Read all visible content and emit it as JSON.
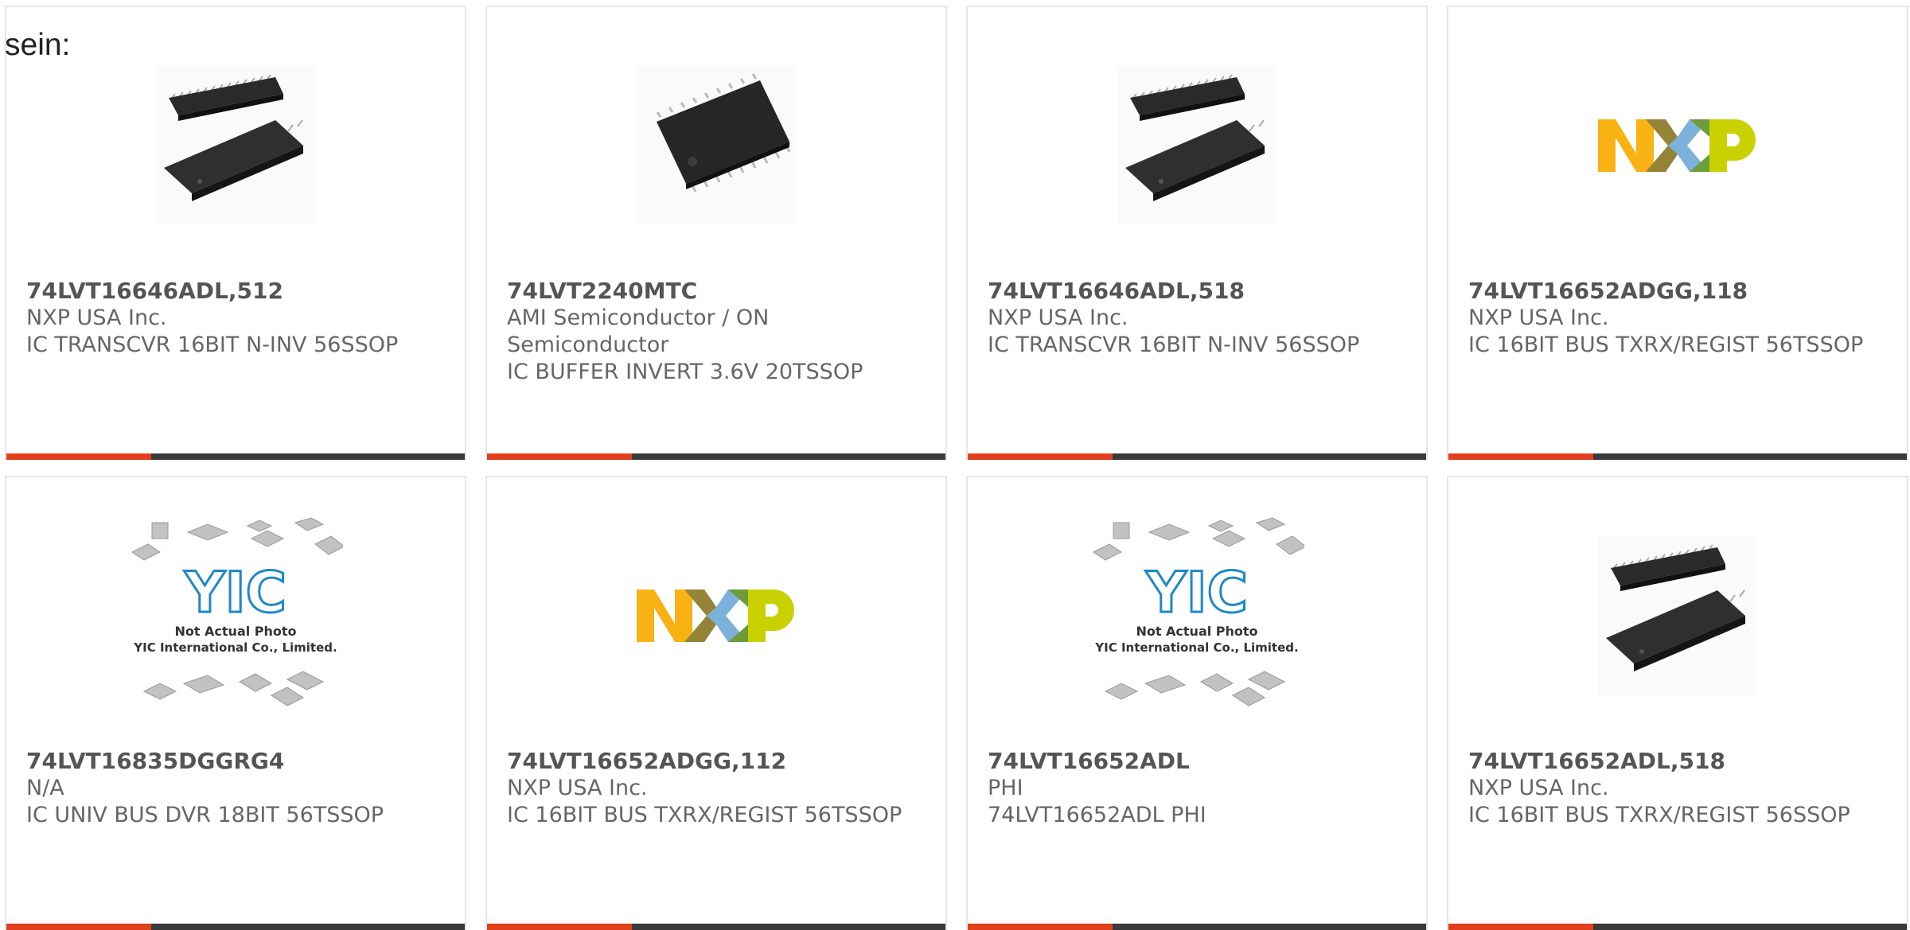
{
  "intro_text": "sein:",
  "colors": {
    "accent": "#e0401c",
    "bar": "#3a3a3a"
  },
  "products": [
    {
      "part": "74LVT16646ADL,512",
      "maker": "NXP USA Inc.",
      "desc": "IC TRANSCVR 16BIT N-INV 56SSOP",
      "image": "chip-ssop-image"
    },
    {
      "part": "74LVT2240MTC",
      "maker": "AMI Semiconductor / ON Semiconductor",
      "desc": "IC BUFFER INVERT 3.6V 20TSSOP",
      "image": "chip-tssop20-image"
    },
    {
      "part": "74LVT16646ADL,518",
      "maker": "NXP USA Inc.",
      "desc": "IC TRANSCVR 16BIT N-INV 56SSOP",
      "image": "chip-ssop-image"
    },
    {
      "part": "74LVT16652ADGG,118",
      "maker": "NXP USA Inc.",
      "desc": "IC 16BIT BUS TXRX/REGIST 56TSSOP",
      "image": "nxp-logo"
    },
    {
      "part": "74LVT16835DGGRG4",
      "maker": "N/A",
      "desc": "IC UNIV BUS DVR 18BIT 56TSSOP",
      "image": "yic-placeholder"
    },
    {
      "part": "74LVT16652ADGG,112",
      "maker": "NXP USA Inc.",
      "desc": "IC 16BIT BUS TXRX/REGIST 56TSSOP",
      "image": "nxp-logo"
    },
    {
      "part": "74LVT16652ADL",
      "maker": "PHI",
      "desc": "74LVT16652ADL PHI",
      "image": "yic-placeholder"
    },
    {
      "part": "74LVT16652ADL,518",
      "maker": "NXP USA Inc.",
      "desc": "IC 16BIT BUS TXRX/REGIST 56SSOP",
      "image": "chip-ssop-image"
    }
  ],
  "yic": {
    "line1": "Not Actual Photo",
    "line2": "YIC International Co., Limited."
  }
}
